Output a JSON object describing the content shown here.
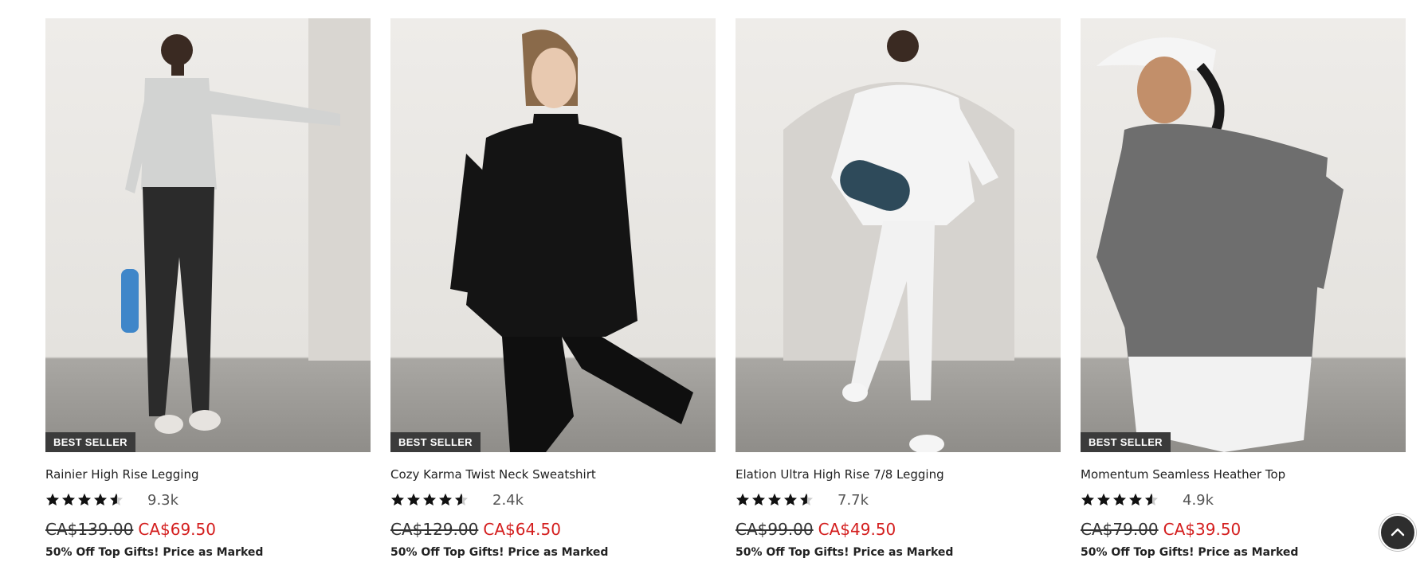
{
  "colors": {
    "sale": "#d41e1e",
    "badge_bg": "#3b3b3b",
    "back_to_top_bg": "#2e2e2e"
  },
  "products": [
    {
      "badge": "BEST SELLER",
      "name": "Rainier High Rise Legging",
      "rating": 4.5,
      "review_count": "9.3k",
      "original_price": "CA$139.00",
      "sale_price": "CA$69.50",
      "promo": "50% Off Top Gifts! Price as Marked"
    },
    {
      "badge": "BEST SELLER",
      "name": "Cozy Karma Twist Neck Sweatshirt",
      "rating": 4.5,
      "review_count": "2.4k",
      "original_price": "CA$129.00",
      "sale_price": "CA$64.50",
      "promo": "50% Off Top Gifts! Price as Marked"
    },
    {
      "badge": "",
      "name": "Elation Ultra High Rise 7/8 Legging",
      "rating": 4.5,
      "review_count": "7.7k",
      "original_price": "CA$99.00",
      "sale_price": "CA$49.50",
      "promo": "50% Off Top Gifts! Price as Marked"
    },
    {
      "badge": "BEST SELLER",
      "name": "Momentum Seamless Heather Top",
      "rating": 4.5,
      "review_count": "4.9k",
      "original_price": "CA$79.00",
      "sale_price": "CA$39.50",
      "promo": "50% Off Top Gifts! Price as Marked"
    }
  ],
  "back_to_top": {
    "icon": "chevron-up-icon"
  }
}
